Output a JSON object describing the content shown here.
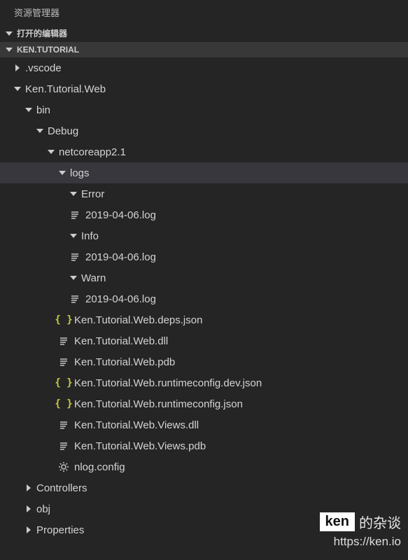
{
  "panel": {
    "title": "资源管理器"
  },
  "sections": {
    "openEditors": "打开的编辑器",
    "project": "KEN.TUTORIAL"
  },
  "tree": {
    "vscode": ".vscode",
    "webProj": "Ken.Tutorial.Web",
    "bin": "bin",
    "debug": "Debug",
    "netcore": "netcoreapp2.1",
    "logs": "logs",
    "error": "Error",
    "errorLog": "2019-04-06.log",
    "info": "Info",
    "infoLog": "2019-04-06.log",
    "warn": "Warn",
    "warnLog": "2019-04-06.log",
    "depsJson": "Ken.Tutorial.Web.deps.json",
    "dll": "Ken.Tutorial.Web.dll",
    "pdb": "Ken.Tutorial.Web.pdb",
    "rtDev": "Ken.Tutorial.Web.runtimeconfig.dev.json",
    "rt": "Ken.Tutorial.Web.runtimeconfig.json",
    "viewsDll": "Ken.Tutorial.Web.Views.dll",
    "viewsPdb": "Ken.Tutorial.Web.Views.pdb",
    "nlog": "nlog.config",
    "controllers": "Controllers",
    "obj": "obj",
    "properties": "Properties"
  },
  "watermark": {
    "brand": "ken",
    "suffix": "的杂谈",
    "url": "https://ken.io"
  }
}
